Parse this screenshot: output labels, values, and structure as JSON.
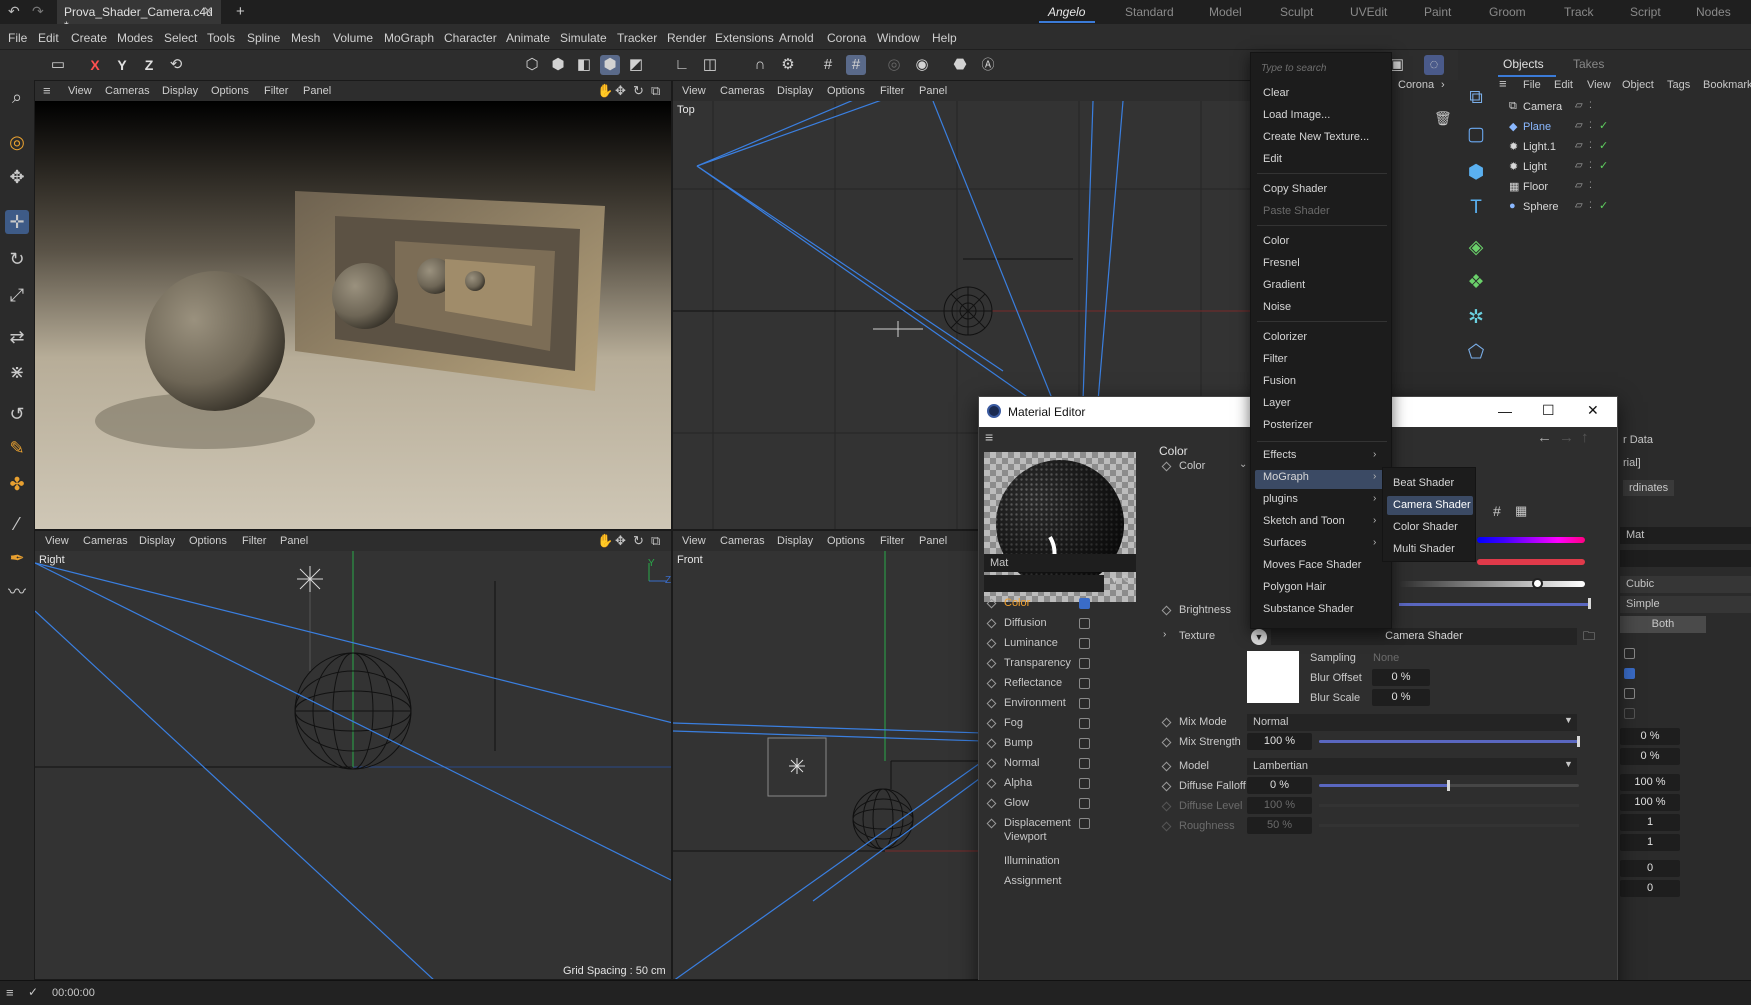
{
  "window": {
    "document_tab": "Prova_Shader_Camera.c4d *",
    "layouts": [
      "Angelo",
      "Standard",
      "Model",
      "Sculpt",
      "UVEdit",
      "Paint",
      "Groom",
      "Track",
      "Script",
      "Nodes"
    ],
    "active_layout": "Angelo"
  },
  "menubar": [
    "File",
    "Edit",
    "Create",
    "Modes",
    "Select",
    "Tools",
    "Spline",
    "Mesh",
    "Volume",
    "MoGraph",
    "Character",
    "Animate",
    "Simulate",
    "Tracker",
    "Render",
    "Extensions",
    "Arnold",
    "Corona",
    "Window",
    "Help"
  ],
  "toolbar": {
    "axis_x": "X",
    "axis_y": "Y",
    "axis_z": "Z"
  },
  "viewports": {
    "menus": [
      "View",
      "Cameras",
      "Display",
      "Options",
      "Filter",
      "Panel"
    ],
    "perspective": {},
    "top": {
      "name": "Top"
    },
    "right": {
      "name": "Right",
      "grid_spacing": "Grid Spacing : 50 cm"
    },
    "front": {
      "name": "Front"
    },
    "axis_labels": {
      "y": "Y",
      "z": "Z"
    }
  },
  "popup": {
    "search_placeholder": "Type to search",
    "items": [
      {
        "label": "Clear"
      },
      {
        "label": "Load Image..."
      },
      {
        "label": "Create New Texture..."
      },
      {
        "label": "Edit"
      },
      {
        "label": "Copy Shader"
      },
      {
        "label": "Paste Shader"
      },
      {
        "label": "Color"
      },
      {
        "label": "Fresnel"
      },
      {
        "label": "Gradient"
      },
      {
        "label": "Noise"
      },
      {
        "label": "Colorizer"
      },
      {
        "label": "Filter"
      },
      {
        "label": "Fusion"
      },
      {
        "label": "Layer"
      },
      {
        "label": "Posterizer"
      },
      {
        "label": "Effects"
      },
      {
        "label": "MoGraph"
      },
      {
        "label": "plugins"
      },
      {
        "label": "Sketch and Toon"
      },
      {
        "label": "Surfaces"
      },
      {
        "label": "Moves Face Shader"
      },
      {
        "label": "Polygon Hair"
      },
      {
        "label": "Substance Shader"
      }
    ],
    "submenu": [
      "Beat Shader",
      "Camera Shader",
      "Color Shader",
      "Multi Shader"
    ],
    "behind_text": "Corona"
  },
  "material_editor": {
    "title": "Material Editor",
    "material_name": "Mat",
    "channels": [
      {
        "label": "Color",
        "checked": true
      },
      {
        "label": "Diffusion",
        "checked": false
      },
      {
        "label": "Luminance",
        "checked": false
      },
      {
        "label": "Transparency",
        "checked": false
      },
      {
        "label": "Reflectance",
        "checked": false
      },
      {
        "label": "Environment",
        "checked": false
      },
      {
        "label": "Fog",
        "checked": false
      },
      {
        "label": "Bump",
        "checked": false
      },
      {
        "label": "Normal",
        "checked": false
      },
      {
        "label": "Alpha",
        "checked": false
      },
      {
        "label": "Glow",
        "checked": false
      },
      {
        "label": "Displacement",
        "checked": false
      }
    ],
    "extras": [
      "Viewport",
      "Illumination",
      "Assignment"
    ],
    "section_title": "Color",
    "color_label": "Color",
    "brightness_label": "Brightness",
    "texture_label": "Texture",
    "texture_value": "Camera Shader",
    "sampling_label": "Sampling",
    "sampling_value": "None",
    "blur_offset_label": "Blur Offset",
    "blur_offset_value": "0 %",
    "blur_scale_label": "Blur Scale",
    "blur_scale_value": "0 %",
    "mix_mode_label": "Mix Mode",
    "mix_mode_value": "Normal",
    "mix_strength_label": "Mix Strength",
    "mix_strength_value": "100 %",
    "mix_strength_fraction": 1.0,
    "model_label": "Model",
    "model_value": "Lambertian",
    "diffuse_falloff_label": "Diffuse Falloff",
    "diffuse_falloff_value": "0 %",
    "diffuse_falloff_fraction": 0.5,
    "diffuse_level_label": "Diffuse Level",
    "diffuse_level_value": "100 %",
    "roughness_label": "Roughness",
    "roughness_value": "50 %"
  },
  "objects_panel": {
    "tabs": [
      "Objects",
      "Takes"
    ],
    "menu": [
      "File",
      "Edit",
      "View",
      "Object",
      "Tags",
      "Bookmarks"
    ],
    "objects": [
      {
        "name": "Camera",
        "color": "#d8d8d8"
      },
      {
        "name": "Plane",
        "color": "#8ab8ff"
      },
      {
        "name": "Light.1",
        "color": "#d8d8d8"
      },
      {
        "name": "Light",
        "color": "#d8d8d8"
      },
      {
        "name": "Floor",
        "color": "#d8d8d8"
      },
      {
        "name": "Sphere",
        "color": "#d8d8d8"
      }
    ]
  },
  "attributes_partial": {
    "tab1": "r Data",
    "tab2": "rial]",
    "tab3": "rdinates",
    "name_value": "Mat",
    "cubic": "Cubic",
    "simple": "Simple",
    "both": "Both",
    "values": [
      "0 %",
      "0 %",
      "100 %",
      "100 %",
      "1",
      "1",
      "0",
      "0"
    ]
  },
  "statusbar": {
    "time": "00:00:00"
  },
  "colors": {
    "accent": "#3b7bd8",
    "menu_highlight": "#3b4a64",
    "checkbox_on": "#3a6cc8",
    "wire_blue": "#3a7fe0"
  }
}
